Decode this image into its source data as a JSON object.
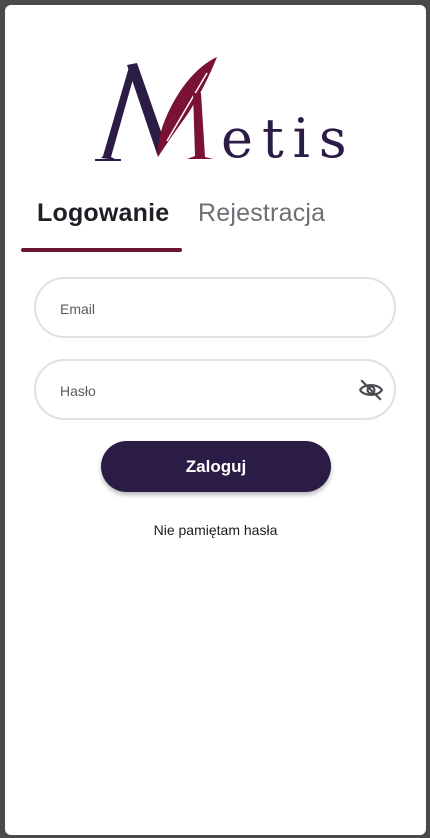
{
  "brand": {
    "logo_text": "Metis",
    "navy": "#2a1c45",
    "crimson": "#7a1233"
  },
  "tabs": [
    {
      "label": "Logowanie",
      "active": true
    },
    {
      "label": "Rejestracja",
      "active": false
    }
  ],
  "form": {
    "email": {
      "value": "",
      "placeholder": "Email"
    },
    "password": {
      "value": "",
      "placeholder": "Hasło",
      "toggle_icon": "eye-off-icon"
    },
    "submit_label": "Zaloguj",
    "forgot_label": "Nie pamiętam hasła"
  }
}
